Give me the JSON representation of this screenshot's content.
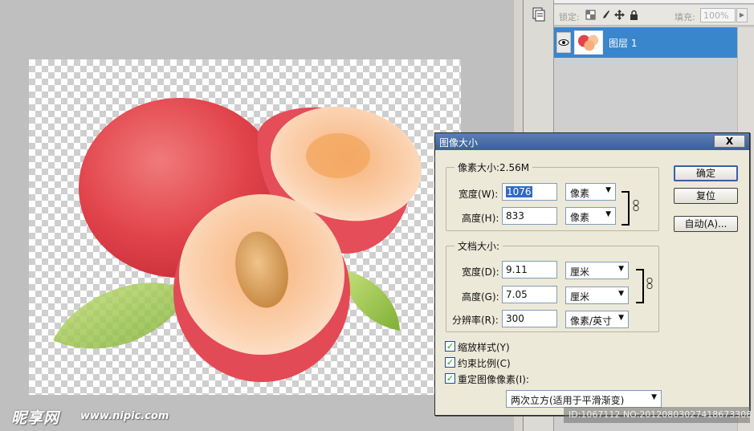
{
  "watermark": {
    "logo_text": "昵享网",
    "url": "www.nipic.com"
  },
  "layers_panel": {
    "lock_label": "锁定:",
    "fill_label": "填充:",
    "fill_value": "100%",
    "layer_name": "图层 1"
  },
  "dialog": {
    "title": "图像大小",
    "close_label": "X",
    "pixel_dimensions": {
      "title": "像素大小:2.56M",
      "width_label": "宽度(W):",
      "width_value": "1076",
      "width_unit": "像素",
      "height_label": "高度(H):",
      "height_value": "833",
      "height_unit": "像素"
    },
    "document_size": {
      "title": "文档大小:",
      "width_label": "宽度(D):",
      "width_value": "9.11",
      "width_unit": "厘米",
      "height_label": "高度(G):",
      "height_value": "7.05",
      "height_unit": "厘米",
      "resolution_label": "分辨率(R):",
      "resolution_value": "300",
      "resolution_unit": "像素/英寸"
    },
    "buttons": {
      "ok": "确定",
      "reset": "复位",
      "auto": "自动(A)..."
    },
    "options": {
      "scale_styles": "缩放样式(Y)",
      "constrain_proportions": "约束比例(C)",
      "resample_image": "重定图像像素(I):",
      "resample_method": "两次立方(适用于平滑渐变)"
    }
  },
  "footer_id": "ID:1067112 NO:20120803027418673308",
  "colors": {
    "selection_blue": "#3a86cc",
    "dialog_bg": "#ece9d8",
    "titlebar": "#4a6ea8",
    "fruit_red": "#e2444c"
  },
  "icons": [
    "history-icon",
    "eye-icon",
    "lock-transparent-icon",
    "brush-icon",
    "move-icon",
    "padlock-icon",
    "chain-link-icon",
    "dropdown-arrow-icon"
  ]
}
